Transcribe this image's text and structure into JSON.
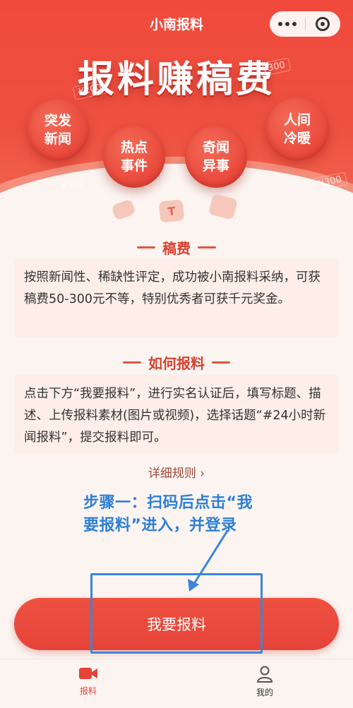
{
  "header": {
    "app_title": "小南报料",
    "banner_headline": "报料赚稿费",
    "money_tags": [
      "¥200",
      "¥300",
      "¥300",
      "¥300"
    ],
    "topics": [
      {
        "line1": "突发",
        "line2": "新闻"
      },
      {
        "line1": "热点",
        "line2": "事件"
      },
      {
        "line1": "奇闻",
        "line2": "异事"
      },
      {
        "line1": "人间",
        "line2": "冷暖"
      }
    ],
    "capsule_icons": [
      "more-icon",
      "close-target-icon"
    ]
  },
  "fee_section": {
    "title": "稿费",
    "body": "按照新闻性、稀缺性评定，成功被小南报料采纳，可获稿费50-300元不等，特别优秀者可获千元奖金。"
  },
  "howto_section": {
    "title": "如何报料",
    "body": "点击下方“我要报料”，进行实名认证后，填写标题、描述、上传报料素材(图片或视频)，选择话题“#24小时新闻报料”，提交报料即可。"
  },
  "rules_link": "详细规则 ›",
  "annotation": {
    "line1": "步骤一：扫码后点击“我",
    "line2": "要报料”进入，并登录"
  },
  "cta_label": "我要报料",
  "tabbar": {
    "items": [
      {
        "label": "报料",
        "icon": "video-camera-icon",
        "active": true
      },
      {
        "label": "我的",
        "icon": "person-icon",
        "active": false
      }
    ]
  },
  "colors": {
    "brand_red": "#ee5140",
    "accent_blue": "#2f7fd6"
  }
}
